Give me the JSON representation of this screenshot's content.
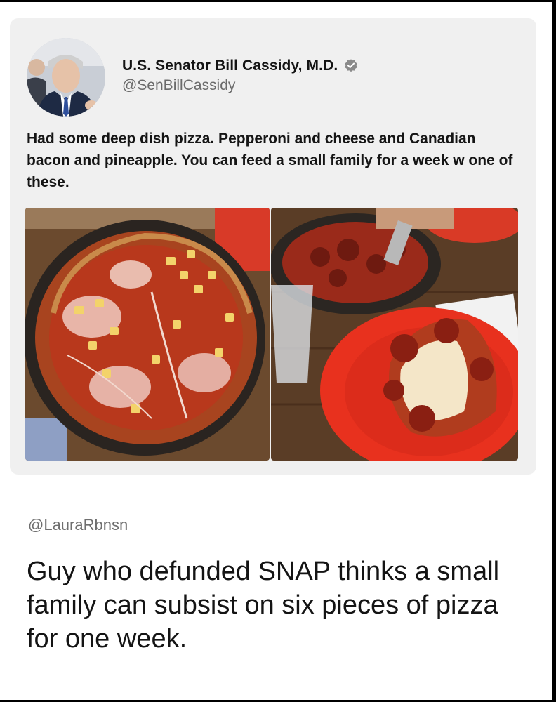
{
  "tweet": {
    "author_name": "U.S. Senator Bill Cassidy, M.D.",
    "author_handle": "@SenBillCassidy",
    "verified_icon": "verified-badge-icon",
    "text": "Had some deep dish pizza. Pepperoni and cheese and Canadian bacon and pineapple. You can feed a small family for a week w one of these.",
    "images": [
      {
        "subject": "deep-dish-pizza-canadian-bacon-pineapple-photo"
      },
      {
        "subject": "deep-dish-pizza-pepperoni-slice-on-red-plate-photo"
      }
    ]
  },
  "reply": {
    "handle": "@LauraRbnsn",
    "text": "Guy who defunded SNAP thinks a small family can subsist on six pieces of pizza for one week."
  },
  "colors": {
    "card_background": "#f0f0f0",
    "handle_gray": "#6b6b6b",
    "verified_gray": "#8a8a8a",
    "plate_red": "#e8311e"
  }
}
